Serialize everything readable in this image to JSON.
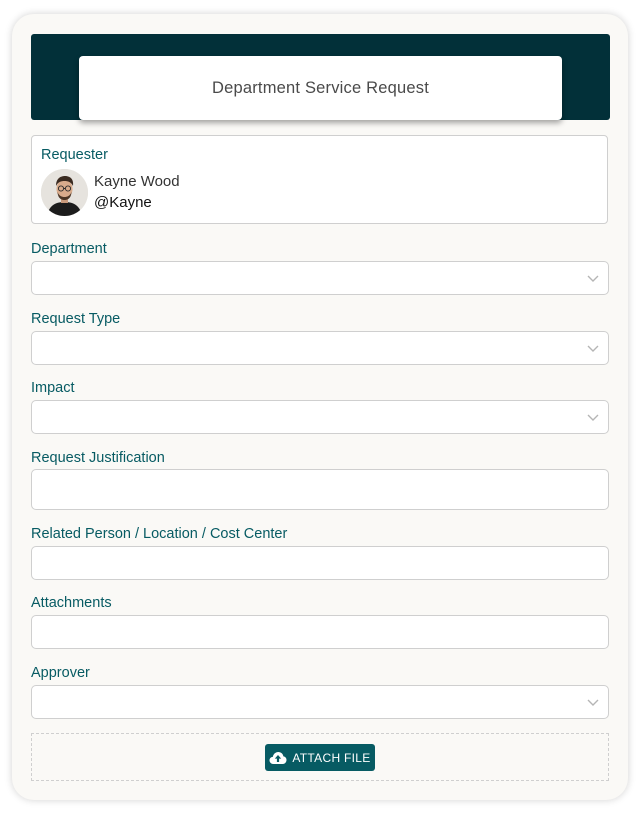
{
  "form": {
    "title": "Department Service Request",
    "requester": {
      "label": "Requester",
      "name": "Kayne Wood",
      "handle": "@Kayne"
    },
    "fields": {
      "department": {
        "label": "Department",
        "type": "select",
        "value": ""
      },
      "request_type": {
        "label": "Request Type",
        "type": "select",
        "value": ""
      },
      "impact": {
        "label": "Impact",
        "type": "select",
        "value": ""
      },
      "request_justification": {
        "label": "Request Justification",
        "type": "text",
        "value": ""
      },
      "related_person": {
        "label": "Related Person / Location / Cost Center",
        "type": "text",
        "value": ""
      },
      "attachments": {
        "label": "Attachments",
        "type": "text",
        "value": ""
      },
      "approver": {
        "label": "Approver",
        "type": "select",
        "value": ""
      }
    },
    "attach_button": {
      "label": "ATTACH FILE",
      "icon": "cloud-upload-icon"
    }
  },
  "colors": {
    "banner": "#023039",
    "accent": "#075b63",
    "card_background": "#faf9f6"
  }
}
